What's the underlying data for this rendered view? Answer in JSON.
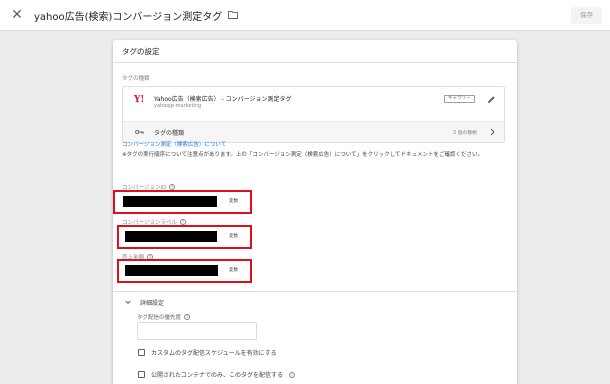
{
  "topbar": {
    "title": "yahoo広告(検索)コンバージョン測定タグ",
    "save_label": "保存"
  },
  "card": {
    "title": "タグの設定",
    "tag_type_section_label": "タグの種類",
    "tag_type": {
      "name": "Yahoo広告（検索広告） - コンバージョン測定タグ",
      "vendor": "yahoojp-marketing",
      "gallery_label": "ギャラリー",
      "subrow_label": "タグの種類",
      "subrow_count": "3 個の種類"
    },
    "help_link": "コンバージョン測定（検索広告）について",
    "help_note": "※タグの実行順序について注意点があります。上の「コンバージョン測定（検索広告）について」をクリックしてドキュメントをご確認ください。",
    "fields": [
      {
        "label": "コンバージョンID",
        "var_button": "変数"
      },
      {
        "label": "コンバージョンラベル",
        "var_button": "変数"
      },
      {
        "label": "売上金額",
        "var_button": "変数"
      }
    ],
    "advanced": {
      "label": "詳細設定",
      "priority_label": "タグ配信の優先度",
      "priority_value": "",
      "checkbox_custom_schedule": "カスタムのタグ配信スケジュールを有効にする",
      "checkbox_published_only": "公開されたコンテナでのみ、このタグを配信する"
    }
  },
  "colors": {
    "highlight": "#e0101a",
    "link": "#1a73e8",
    "yahoo_red": "#e60033"
  }
}
